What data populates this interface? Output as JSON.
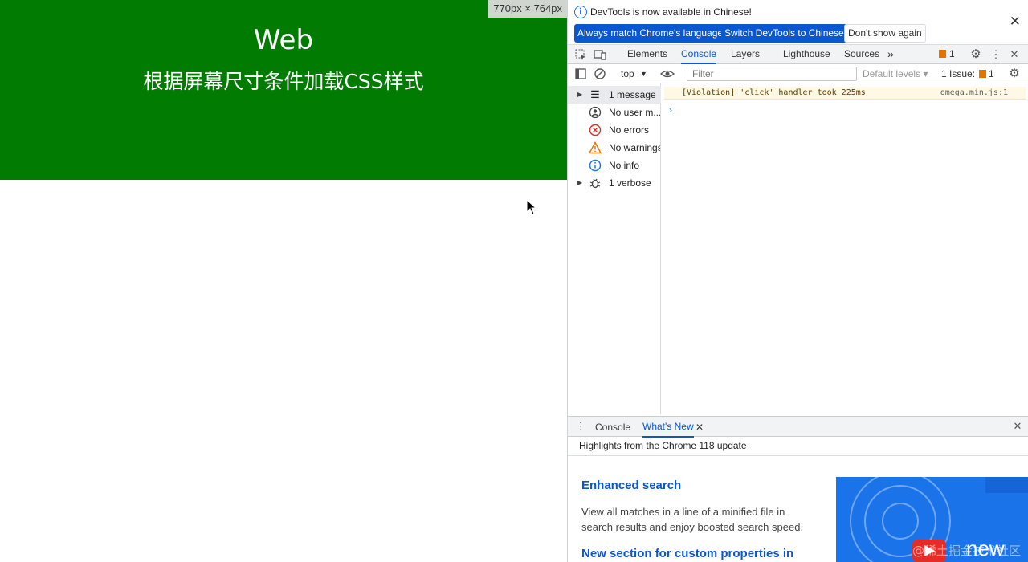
{
  "page": {
    "hero_title": "Web",
    "hero_subtitle": "根据屏幕尺寸条件加载CSS样式",
    "viewport_size": "770px × 764px",
    "hero_color": "#017b01"
  },
  "devtools": {
    "infobar": {
      "message": "DevTools is now available in Chinese!",
      "btn_match": "Always match Chrome's language",
      "btn_switch": "Switch DevTools to Chinese",
      "btn_dismiss": "Don't show again",
      "close": "✕"
    },
    "tabs": {
      "elements": "Elements",
      "console": "Console",
      "layers": "Layers",
      "lighthouse": "Lighthouse",
      "sources": "Sources",
      "more": "»",
      "issue_count": "1"
    },
    "consolebar": {
      "context": "top",
      "filter_placeholder": "Filter",
      "levels": "Default levels ▾",
      "issues_label": "1 Issue:",
      "issues_count": "1"
    },
    "sidebar": [
      {
        "label": "1 message",
        "icon": "list-icon"
      },
      {
        "label": "No user m...",
        "icon": "user-icon"
      },
      {
        "label": "No errors",
        "icon": "error-icon"
      },
      {
        "label": "No warnings",
        "icon": "warning-icon"
      },
      {
        "label": "No info",
        "icon": "info-icon"
      },
      {
        "label": "1 verbose",
        "icon": "bug-icon"
      }
    ],
    "message": {
      "text": "[Violation] 'click' handler took 225ms",
      "source": "omega.min.js:1"
    },
    "drawer": {
      "tab_console": "Console",
      "tab_whats_new": "What's New",
      "highlights": "Highlights from the Chrome 118 update",
      "feature1_title": "Enhanced search",
      "feature1_body": "View all matches in a line of a minified file in search results and enjoy boosted search speed.",
      "feature2_title": "New section for custom properties in",
      "promo_word": "new",
      "watermark": "@稀土掘金技术社区"
    }
  }
}
